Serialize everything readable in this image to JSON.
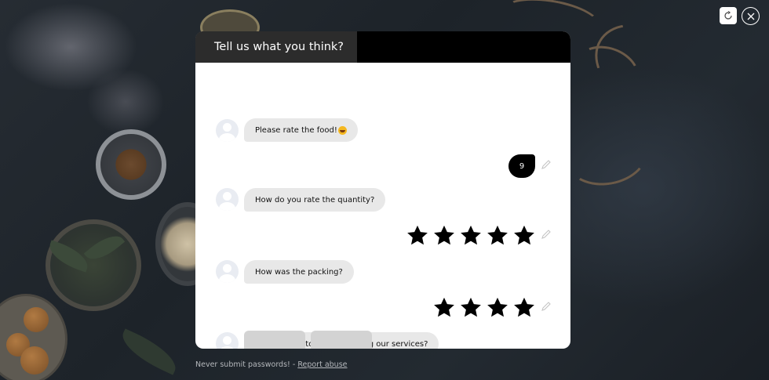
{
  "chat": {
    "header_title": "Tell us what you think?",
    "messages": [
      {
        "text": "Please rate the food!",
        "emoji": "grinning-face-emoji"
      },
      {
        "text": "How do you rate the quantity?"
      },
      {
        "text": "How was the packing?"
      },
      {
        "text": "Do you wish to continue using our services?"
      }
    ],
    "user_reply_number": "9",
    "quantity_rating": 5,
    "packing_rating": 4
  },
  "footer": {
    "warning_text": "Never submit passwords! - ",
    "report_link": "Report abuse"
  },
  "icons": {
    "refresh": "refresh-icon",
    "close": "close-icon",
    "edit": "pencil-icon",
    "star": "star-icon"
  },
  "colors": {
    "header_bg": "#000000",
    "title_box_bg": "#2c2c2c",
    "bot_bubble": "#e8e8e8",
    "user_bubble": "#000000",
    "option_button": "#d3d3d3"
  }
}
